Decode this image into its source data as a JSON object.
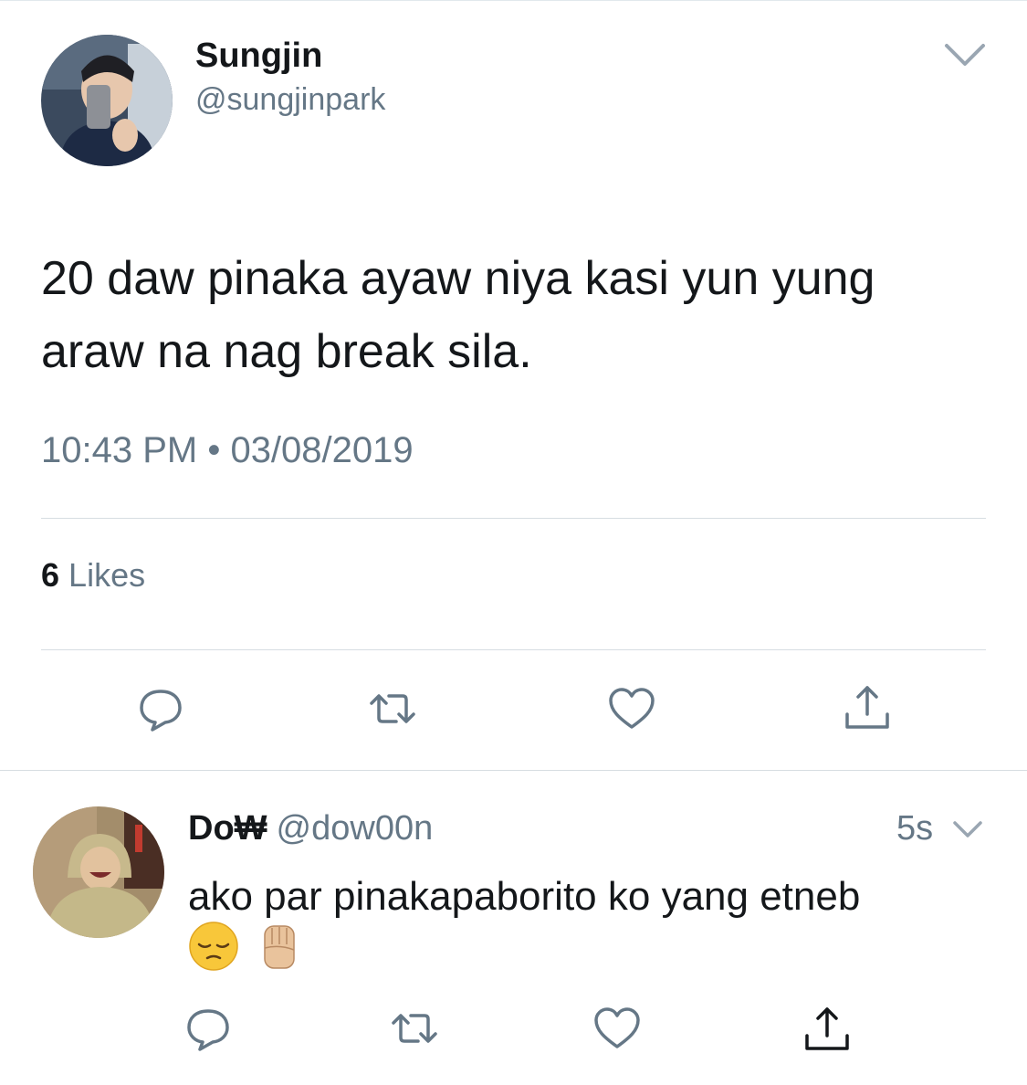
{
  "tweet": {
    "author_name": "Sungjin",
    "author_handle": "@sungjinpark",
    "text": "20 daw pinaka ayaw niya kasi yun yung araw na nag break sila.",
    "timestamp": "10:43 PM • 03/08/2019",
    "likes_count": "6",
    "likes_label": "Likes"
  },
  "reply": {
    "author_name": "Do₩",
    "author_handle": "@dow00n",
    "time": "5s",
    "text": "ako par pinakapaborito ko yang etneb",
    "emojis": [
      "pensive-face-emoji",
      "raised-fist-emoji"
    ]
  },
  "colors": {
    "text_primary": "#14171a",
    "text_secondary": "#657786",
    "icon_gray": "#657786",
    "divider": "#d7dde2"
  }
}
